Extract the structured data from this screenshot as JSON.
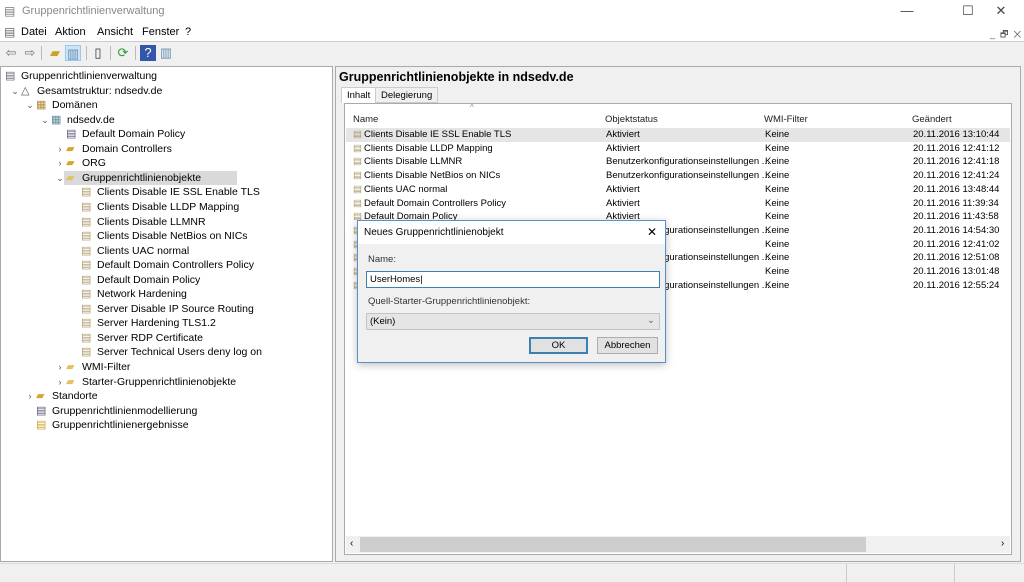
{
  "window": {
    "title": "Gruppenrichtlinienverwaltung",
    "minimize": "—",
    "maximize": "☐",
    "close": "✕"
  },
  "menu": [
    "Datei",
    "Aktion",
    "Ansicht",
    "Fenster",
    "?"
  ],
  "toolbar": [
    "back-icon",
    "forward-icon",
    "up-folder-icon",
    "show-hide-tree-icon",
    "properties-icon",
    "refresh-icon",
    "help-icon",
    "action-pane-icon"
  ],
  "tree": [
    {
      "label": "Gruppenrichtlinienverwaltung",
      "depth": 0,
      "chevron": "",
      "icon": "gpmc-icon"
    },
    {
      "label": "Gesamtstruktur: ndsedv.de",
      "depth": 1,
      "chevron": "expanded",
      "icon": "forest-icon"
    },
    {
      "label": "Domänen",
      "depth": 2,
      "chevron": "expanded",
      "icon": "domains-icon"
    },
    {
      "label": "ndsedv.de",
      "depth": 3,
      "chevron": "expanded",
      "icon": "domain-icon"
    },
    {
      "label": "Default Domain Policy",
      "depth": 4,
      "chevron": "",
      "icon": "gpo-link-icon"
    },
    {
      "label": "Domain Controllers",
      "depth": 4,
      "chevron": "collapsed",
      "icon": "ou-icon"
    },
    {
      "label": "ORG",
      "depth": 4,
      "chevron": "collapsed",
      "icon": "ou-icon"
    },
    {
      "label": "Gruppenrichtlinienobjekte",
      "depth": 4,
      "chevron": "expanded",
      "icon": "folder-icon",
      "selected": true
    },
    {
      "label": "Clients Disable IE SSL Enable TLS",
      "depth": 5,
      "chevron": "",
      "icon": "gpo-icon"
    },
    {
      "label": "Clients Disable LLDP Mapping",
      "depth": 5,
      "chevron": "",
      "icon": "gpo-icon"
    },
    {
      "label": "Clients Disable LLMNR",
      "depth": 5,
      "chevron": "",
      "icon": "gpo-icon"
    },
    {
      "label": "Clients Disable NetBios on NICs",
      "depth": 5,
      "chevron": "",
      "icon": "gpo-icon"
    },
    {
      "label": "Clients UAC normal",
      "depth": 5,
      "chevron": "",
      "icon": "gpo-icon"
    },
    {
      "label": "Default Domain Controllers Policy",
      "depth": 5,
      "chevron": "",
      "icon": "gpo-icon"
    },
    {
      "label": "Default Domain Policy",
      "depth": 5,
      "chevron": "",
      "icon": "gpo-icon"
    },
    {
      "label": "Network Hardening",
      "depth": 5,
      "chevron": "",
      "icon": "gpo-icon"
    },
    {
      "label": "Server Disable IP Source Routing",
      "depth": 5,
      "chevron": "",
      "icon": "gpo-icon"
    },
    {
      "label": "Server Hardening TLS1.2",
      "depth": 5,
      "chevron": "",
      "icon": "gpo-icon"
    },
    {
      "label": "Server RDP Certificate",
      "depth": 5,
      "chevron": "",
      "icon": "gpo-icon"
    },
    {
      "label": "Server Technical Users deny log on",
      "depth": 5,
      "chevron": "",
      "icon": "gpo-icon"
    },
    {
      "label": "WMI-Filter",
      "depth": 4,
      "chevron": "collapsed",
      "icon": "folder-icon"
    },
    {
      "label": "Starter-Gruppenrichtlinienobjekte",
      "depth": 4,
      "chevron": "collapsed",
      "icon": "folder-icon"
    },
    {
      "label": "Standorte",
      "depth": 2,
      "chevron": "collapsed",
      "icon": "sites-icon"
    },
    {
      "label": "Gruppenrichtlinienmodellierung",
      "depth": 2,
      "chevron": "",
      "icon": "modeling-icon"
    },
    {
      "label": "Gruppenrichtlinienergebnisse",
      "depth": 2,
      "chevron": "",
      "icon": "results-icon"
    }
  ],
  "right": {
    "title": "Gruppenrichtlinienobjekte in ndsedv.de",
    "tabs": [
      "Inhalt",
      "Delegierung"
    ],
    "columns": [
      "Name",
      "Objektstatus",
      "WMI-Filter",
      "Geändert"
    ],
    "rows": [
      [
        "Clients Disable IE SSL Enable TLS",
        "Aktiviert",
        "Keine",
        "20.11.2016 13:10:44"
      ],
      [
        "Clients Disable LLDP Mapping",
        "Aktiviert",
        "Keine",
        "20.11.2016 12:41:12"
      ],
      [
        "Clients Disable LLMNR",
        "Benutzerkonfigurationseinstellungen ...",
        "Keine",
        "20.11.2016 12:41:18"
      ],
      [
        "Clients Disable NetBios on NICs",
        "Benutzerkonfigurationseinstellungen ...",
        "Keine",
        "20.11.2016 12:41:24"
      ],
      [
        "Clients UAC normal",
        "Aktiviert",
        "Keine",
        "20.11.2016 13:48:44"
      ],
      [
        "Default Domain Controllers Policy",
        "Aktiviert",
        "Keine",
        "20.11.2016 11:39:34"
      ],
      [
        "Default Domain Policy",
        "Aktiviert",
        "Keine",
        "20.11.2016 11:43:58"
      ],
      [
        "Network Hardening",
        "Benutzerkonfigurationseinstellungen ...",
        "Keine",
        "20.11.2016 14:54:30"
      ],
      [
        "Server Disable IP Source Routing",
        "",
        "Keine",
        "20.11.2016 12:41:02"
      ],
      [
        "Server Hardening TLS1.2",
        "Benutzerkonfigurationseinstellungen ...",
        "Keine",
        "20.11.2016 12:51:08"
      ],
      [
        "Server RDP Certificate",
        "",
        "Keine",
        "20.11.2016 13:01:48"
      ],
      [
        "Server Technical Users deny log on",
        "Benutzerkonfigurationseinstellungen ...",
        "Keine",
        "20.11.2016 12:55:24"
      ]
    ]
  },
  "dialog": {
    "title": "Neues Gruppenrichtlinienobjekt",
    "name_label": "Name:",
    "name_value": "UserHomes",
    "source_label": "Quell-Starter-Gruppenrichtlinienobjekt:",
    "source_value": "(Kein)",
    "ok": "OK",
    "cancel": "Abbrechen",
    "close": "✕"
  },
  "colors": {
    "selection": "#d9d9d9",
    "dialog_border": "#5b8fc7",
    "ok_border": "#3c7fb1"
  }
}
